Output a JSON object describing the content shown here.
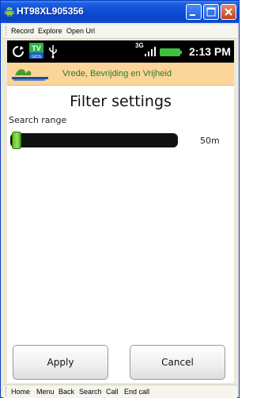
{
  "window": {
    "title": "HT98XL905356",
    "colors": {
      "titlebar": "#0a4ad2",
      "close": "#c4411d"
    }
  },
  "menubar": {
    "items": [
      "Record",
      "Explore",
      "Open Url"
    ]
  },
  "statusbar": {
    "icons": [
      "sync-icon",
      "tv-gids-icon",
      "usb-icon",
      "3g-icon",
      "signal-icon",
      "battery-icon"
    ],
    "network": "3G",
    "time": "2:13 PM"
  },
  "app": {
    "header_title": "Vrede, Bevrijding en Vrijheid",
    "logo": "institution-logo",
    "colors": {
      "header_bg": "#fbd59a",
      "header_text": "#2d7a2d",
      "slider_thumb": "#7dd13c"
    }
  },
  "filter": {
    "title": "Filter settings",
    "range_label": "Search range",
    "range_value": "50m",
    "slider_fraction": 0.0
  },
  "buttons": {
    "apply": "Apply",
    "cancel": "Cancel"
  },
  "bottombar": {
    "items": [
      "Home",
      "Menu",
      "Back",
      "Search",
      "Call",
      "End call"
    ]
  }
}
